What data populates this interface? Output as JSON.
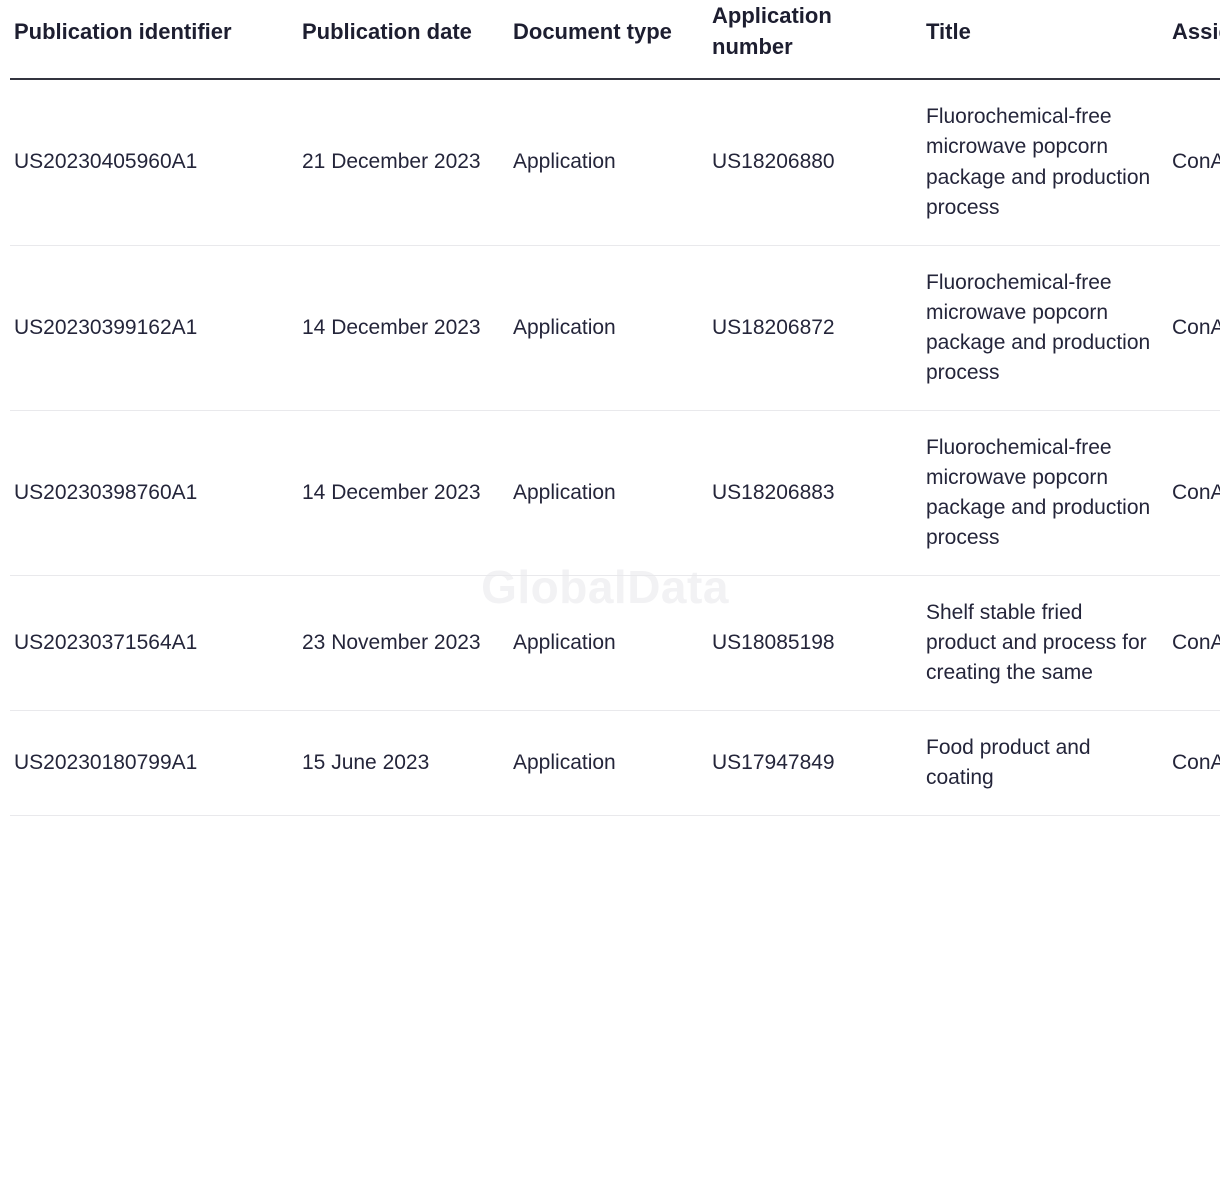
{
  "watermark": {
    "text": "GlobalData"
  },
  "table": {
    "columns": [
      {
        "key": "publication_identifier",
        "label": "Publication identifier"
      },
      {
        "key": "publication_date",
        "label": "Publication date"
      },
      {
        "key": "document_type",
        "label": "Document type"
      },
      {
        "key": "application_number",
        "label": "Application number"
      },
      {
        "key": "title",
        "label": "Title"
      },
      {
        "key": "assignee",
        "label": "Assignee"
      }
    ],
    "rows": [
      {
        "publication_identifier": "US20230405960A1",
        "publication_date": "21 December 2023",
        "document_type": "Application",
        "application_number": "US18206880",
        "title": "Fluorochemical-free microwave popcorn package and production process",
        "assignee": "ConAgra Foods RDM Inc"
      },
      {
        "publication_identifier": "US20230399162A1",
        "publication_date": "14 December 2023",
        "document_type": "Application",
        "application_number": "US18206872",
        "title": "Fluorochemical-free microwave popcorn package and production process",
        "assignee": "ConAgra Foods RDM Inc"
      },
      {
        "publication_identifier": "US20230398760A1",
        "publication_date": "14 December 2023",
        "document_type": "Application",
        "application_number": "US18206883",
        "title": "Fluorochemical-free microwave popcorn package and production process",
        "assignee": "ConAgra Foods RDM Inc"
      },
      {
        "publication_identifier": "US20230371564A1",
        "publication_date": "23 November 2023",
        "document_type": "Application",
        "application_number": "US18085198",
        "title": "Shelf stable fried product and process for creating the same",
        "assignee": "ConAgra Foods RDM Inc"
      },
      {
        "publication_identifier": "US20230180799A1",
        "publication_date": "15 June 2023",
        "document_type": "Application",
        "application_number": "US17947849",
        "title": "Food product and coating",
        "assignee": "ConAgra Foods RDM Inc"
      }
    ]
  },
  "colors": {
    "text": "#24253a",
    "header_text": "#1d1e30",
    "header_rule": "#33343f",
    "row_rule": "#e9e9ec",
    "watermark": "#f2f2f4",
    "background": "#ffffff"
  }
}
